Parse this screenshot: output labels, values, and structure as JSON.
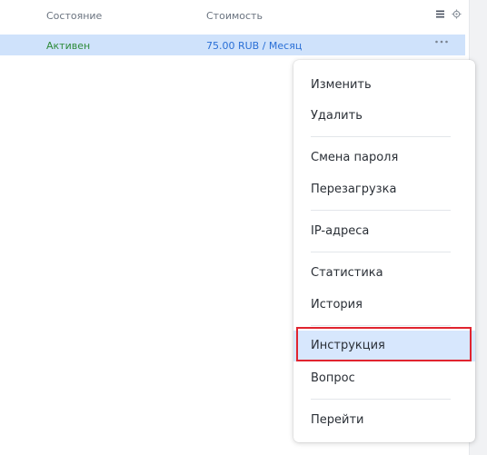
{
  "table": {
    "headers": {
      "state": "Состояние",
      "cost": "Стоимость"
    },
    "row": {
      "state": "Активен",
      "cost": "75.00 RUB / Месяц"
    }
  },
  "menu": {
    "items": [
      {
        "label": "Изменить"
      },
      {
        "label": "Удалить"
      },
      {
        "label": "Смена пароля"
      },
      {
        "label": "Перезагрузка"
      },
      {
        "label": "IP-адреса"
      },
      {
        "label": "Статистика"
      },
      {
        "label": "История"
      },
      {
        "label": "Инструкция",
        "highlighted": true
      },
      {
        "label": "Вопрос"
      },
      {
        "label": "Перейти"
      }
    ]
  },
  "colors": {
    "status_active": "#2e8b3a",
    "cost_link": "#2a6fd6",
    "selected_row": "#cfe2fb",
    "highlight": "#d7e7fd",
    "annotation_box": "#e0242f"
  },
  "icons": {
    "columns_menu": "hamburger-icon",
    "table_settings": "gear-icon",
    "row_actions": "more-dots-icon"
  }
}
